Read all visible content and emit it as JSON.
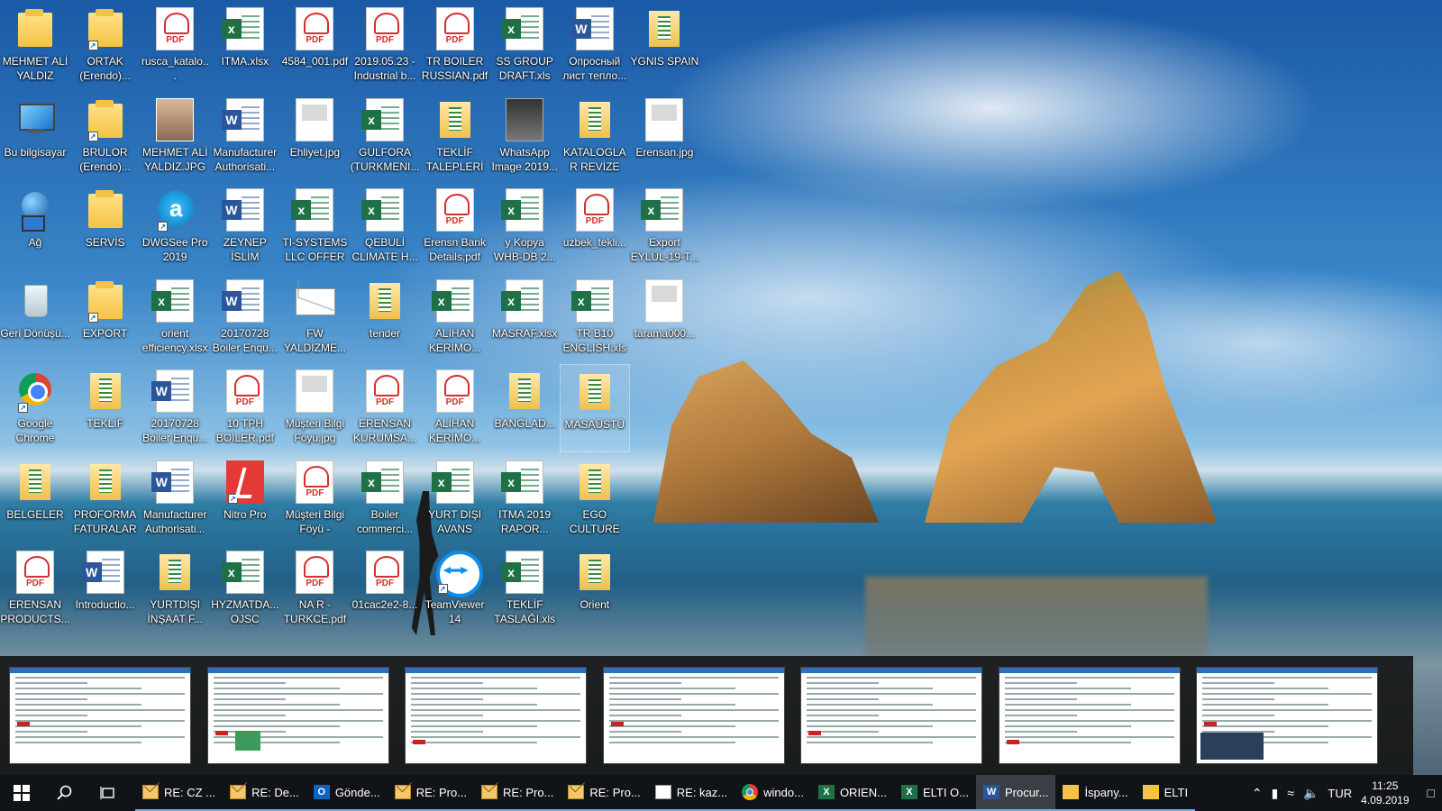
{
  "desktop": {
    "icons": [
      {
        "label": "MEHMET ALİ YALDIZ",
        "type": "folder",
        "col": 0,
        "row": 0
      },
      {
        "label": "ORTAK (Erendo)...",
        "type": "folder",
        "col": 1,
        "row": 0,
        "shortcut": true
      },
      {
        "label": "rusca_katalo...",
        "type": "pdf",
        "col": 2,
        "row": 0
      },
      {
        "label": "ITMA.xlsx",
        "type": "xls",
        "col": 3,
        "row": 0
      },
      {
        "label": "4584_001.pdf",
        "type": "pdf",
        "col": 4,
        "row": 0
      },
      {
        "label": "2019.05.23 - Industrial b...",
        "type": "pdf",
        "col": 5,
        "row": 0
      },
      {
        "label": "TR BOILER RUSSIAN.pdf",
        "type": "pdf",
        "col": 6,
        "row": 0
      },
      {
        "label": "SS GROUP DRAFT.xls",
        "type": "xls",
        "col": 7,
        "row": 0
      },
      {
        "label": "Опросный лист тепло...",
        "type": "doc",
        "col": 8,
        "row": 0
      },
      {
        "label": "YGNIS SPAIN",
        "type": "folderdoc",
        "col": 9,
        "row": 0
      },
      {
        "label": "Bu bilgisayar",
        "type": "pc",
        "col": 0,
        "row": 1
      },
      {
        "label": "BRULOR (Erendo)...",
        "type": "folder",
        "col": 1,
        "row": 1,
        "shortcut": true
      },
      {
        "label": "MEHMET ALİ YALDIZ.JPG",
        "type": "photo",
        "col": 2,
        "row": 1
      },
      {
        "label": "Manufacturer Authorisati...",
        "type": "doc",
        "col": 3,
        "row": 1
      },
      {
        "label": "Ehliyet.jpg",
        "type": "img",
        "col": 4,
        "row": 1
      },
      {
        "label": "GULFORA (TURKMENI...",
        "type": "xls",
        "col": 5,
        "row": 1
      },
      {
        "label": "TEKLİF TALEPLERİ",
        "type": "folderdoc",
        "col": 6,
        "row": 1
      },
      {
        "label": "WhatsApp Image 2019...",
        "type": "photo2",
        "col": 7,
        "row": 1
      },
      {
        "label": "KATALOGLAR REVİZE",
        "type": "folderdoc",
        "col": 8,
        "row": 1
      },
      {
        "label": "Erensan.jpg",
        "type": "img",
        "col": 9,
        "row": 1
      },
      {
        "label": "Ağ",
        "type": "net",
        "col": 0,
        "row": 2
      },
      {
        "label": "SERVİS",
        "type": "folder",
        "col": 1,
        "row": 2
      },
      {
        "label": "DWGSee Pro 2019",
        "type": "dwg",
        "col": 2,
        "row": 2,
        "shortcut": true
      },
      {
        "label": "ZEYNEP İSLİM SCHE...",
        "type": "doc",
        "col": 3,
        "row": 2
      },
      {
        "label": "TI-SYSTEMS LLC OFFER E...",
        "type": "xls",
        "col": 4,
        "row": 2
      },
      {
        "label": "QEBULİ CLIMATE H...",
        "type": "xls",
        "col": 5,
        "row": 2
      },
      {
        "label": "Erensn Bank Details.pdf",
        "type": "pdf",
        "col": 6,
        "row": 2
      },
      {
        "label": "y Kopya WHB-DB 2...",
        "type": "xls",
        "col": 7,
        "row": 2
      },
      {
        "label": "uzbek_tekli...",
        "type": "pdf",
        "col": 8,
        "row": 2
      },
      {
        "label": "Export EYLÜL-19-T...",
        "type": "xls",
        "col": 9,
        "row": 2
      },
      {
        "label": "Geri Dönüşü...",
        "type": "bin",
        "col": 0,
        "row": 3
      },
      {
        "label": "EXPORT",
        "type": "folder",
        "col": 1,
        "row": 3,
        "shortcut": true
      },
      {
        "label": "orient efficiency.xlsx",
        "type": "xls",
        "col": 2,
        "row": 3
      },
      {
        "label": "20170728 Boiler Enqu...",
        "type": "doc",
        "col": 3,
        "row": 3
      },
      {
        "label": "FW YALDIZME...",
        "type": "mail",
        "col": 4,
        "row": 3
      },
      {
        "label": "tender",
        "type": "folderdoc",
        "col": 5,
        "row": 3
      },
      {
        "label": "ALİHAN KERİMO...",
        "type": "xls",
        "col": 6,
        "row": 3
      },
      {
        "label": "MASRAF.xlsx",
        "type": "xls",
        "col": 7,
        "row": 3
      },
      {
        "label": "TR B10 ENGLISH.xls",
        "type": "xls",
        "col": 8,
        "row": 3
      },
      {
        "label": "tarama000...",
        "type": "img",
        "col": 9,
        "row": 3
      },
      {
        "label": "Google Chrome",
        "type": "chrome",
        "col": 0,
        "row": 4,
        "shortcut": true
      },
      {
        "label": "TEKLİF",
        "type": "folderdoc",
        "col": 1,
        "row": 4
      },
      {
        "label": "20170728 Boiler Enqu...",
        "type": "doc",
        "col": 2,
        "row": 4
      },
      {
        "label": "10 TPH BOILER.pdf",
        "type": "pdf",
        "col": 3,
        "row": 4
      },
      {
        "label": "Müşteri Bilgi Föyü.jpg",
        "type": "img",
        "col": 4,
        "row": 4
      },
      {
        "label": "ERENSAN KURUMSA...",
        "type": "pdf",
        "col": 5,
        "row": 4
      },
      {
        "label": "ALİHAN KERİMO...",
        "type": "pdf",
        "col": 6,
        "row": 4
      },
      {
        "label": "BANGLAD...",
        "type": "folderdoc",
        "col": 7,
        "row": 4
      },
      {
        "label": "MASAÜSTÜ",
        "type": "folderdoc",
        "col": 8,
        "row": 4,
        "selected": true
      },
      {
        "label": "BELGELER",
        "type": "folderdoc",
        "col": 0,
        "row": 5
      },
      {
        "label": "PROFORMA FATURALAR",
        "type": "folderdoc",
        "col": 1,
        "row": 5
      },
      {
        "label": "Manufacturer Authorisati...",
        "type": "doc",
        "col": 2,
        "row": 5
      },
      {
        "label": "Nitro Pro",
        "type": "nitro",
        "col": 3,
        "row": 5,
        "shortcut": true
      },
      {
        "label": "Müşteri Bilgi Föyü - GULF...",
        "type": "pdf",
        "col": 4,
        "row": 5
      },
      {
        "label": "Boiler commerci...",
        "type": "xls",
        "col": 5,
        "row": 5
      },
      {
        "label": "YURT DIŞI AVANS TALE...",
        "type": "xls",
        "col": 6,
        "row": 5
      },
      {
        "label": "ITMA 2019 RAPOR...",
        "type": "xls",
        "col": 7,
        "row": 5
      },
      {
        "label": "EGO CULTURE",
        "type": "folderdoc",
        "col": 8,
        "row": 5
      },
      {
        "label": "ERENSAN PRODUCTS...",
        "type": "pdf",
        "col": 0,
        "row": 6
      },
      {
        "label": "Introductio...",
        "type": "doc",
        "col": 1,
        "row": 6
      },
      {
        "label": "YURTDIŞI İNŞAAT F...",
        "type": "folderdoc",
        "col": 2,
        "row": 6
      },
      {
        "label": "HYZMATDA... OJSC OFFER...",
        "type": "xls",
        "col": 3,
        "row": 6
      },
      {
        "label": "NA R - TURKCE.pdf",
        "type": "pdf",
        "col": 4,
        "row": 6
      },
      {
        "label": "01cac2e2-8...",
        "type": "pdf",
        "col": 5,
        "row": 6
      },
      {
        "label": "TeamViewer 14",
        "type": "tv",
        "col": 6,
        "row": 6,
        "shortcut": true
      },
      {
        "label": "TEKLİF TASLAĞI.xls",
        "type": "xls",
        "col": 7,
        "row": 6
      },
      {
        "label": "Orient",
        "type": "folderdoc",
        "col": 8,
        "row": 6
      }
    ]
  },
  "thumbnails": {
    "count": 7
  },
  "taskbar": {
    "start_icon": "windows-start-icon",
    "search_icon": "search-icon",
    "taskview_icon": "task-view-icon",
    "buttons": [
      {
        "label": "RE: CZ ...",
        "icon": "mail"
      },
      {
        "label": "RE: De...",
        "icon": "mail"
      },
      {
        "label": "Gönde...",
        "icon": "outlook"
      },
      {
        "label": "RE: Pro...",
        "icon": "mail"
      },
      {
        "label": "RE: Pro...",
        "icon": "mail"
      },
      {
        "label": "RE: Pro...",
        "icon": "mail"
      },
      {
        "label": "RE: kaz...",
        "icon": "doc"
      },
      {
        "label": "windo...",
        "icon": "chrome"
      },
      {
        "label": "ORIEN...",
        "icon": "excel"
      },
      {
        "label": "ELTI O...",
        "icon": "excel"
      },
      {
        "label": "Procur...",
        "icon": "word",
        "active": true
      },
      {
        "label": "İspany...",
        "icon": "folder"
      },
      {
        "label": "ELTI",
        "icon": "folder"
      }
    ],
    "tray": {
      "language": "TUR",
      "time": "11:25",
      "date": "4.09.2019"
    }
  }
}
